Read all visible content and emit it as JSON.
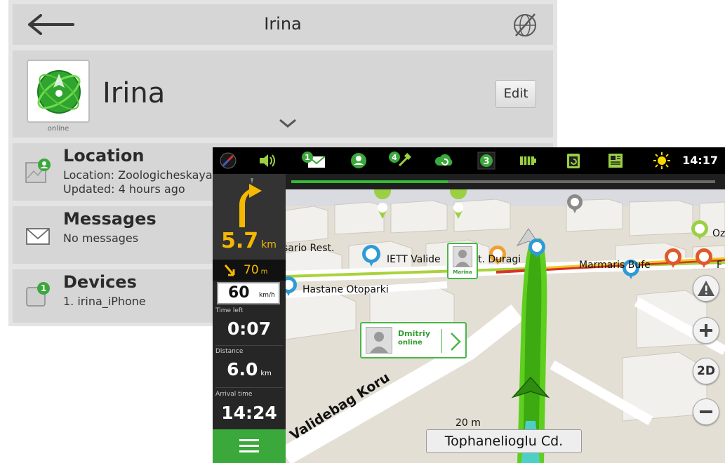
{
  "contact": {
    "header_title": "Irina",
    "name": "Irina",
    "status": "online",
    "edit_label": "Edit",
    "location": {
      "title": "Location",
      "line1": "Location: Zoologicheskaya",
      "line2": "Updated: 4 hours ago"
    },
    "messages": {
      "title": "Messages",
      "line1": "No messages"
    },
    "devices": {
      "title": "Devices",
      "badge": "1",
      "line1": "1. irina_iPhone"
    }
  },
  "navigation": {
    "status_bar": {
      "mail_badge": "1",
      "satellite_badge": "4",
      "box_badge": "3",
      "time": "14:17"
    },
    "route_progress": 0.37,
    "panel": {
      "turn_distance": "5.7",
      "turn_distance_unit": "km",
      "next_turn_distance": "70",
      "next_turn_unit": "m",
      "speed": "60",
      "speed_unit": "km/h",
      "time_left_label": "Time left",
      "time_left": "0:07",
      "distance_label": "Distance",
      "distance": "6.0",
      "distance_unit": "km",
      "arrival_label": "Arrival time",
      "arrival": "14:24"
    },
    "map": {
      "labels": [
        "sario Rest.",
        "IETT Valide",
        "t. Duragi",
        "Hastane Otoparki",
        "Marmaris Bufe",
        "Oz",
        "F"
      ],
      "street_rotated": "Validebag Koru",
      "scale": "20 m",
      "current_street": "Tophanelioglu Cd.",
      "friend_card": {
        "name": "Dmitriy",
        "status": "online"
      },
      "friend_pin": {
        "name": "Marina"
      },
      "zoom_mode": "2D"
    },
    "colors": {
      "accent": "#3aa83a",
      "route": "#5fcf1f",
      "highlight": "#f5b800"
    }
  }
}
